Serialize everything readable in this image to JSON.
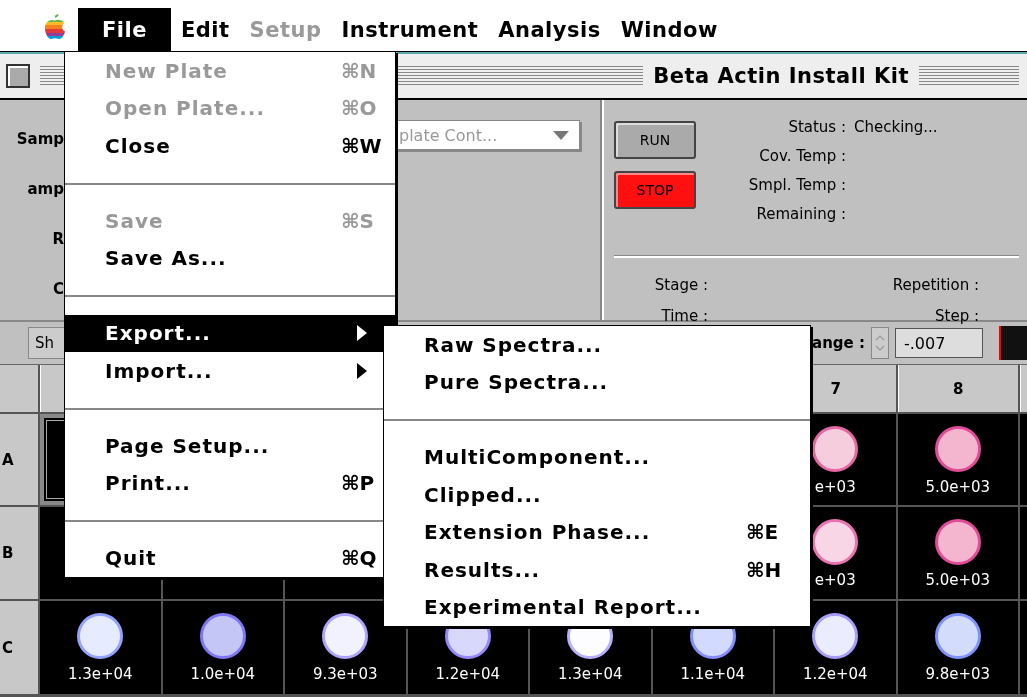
{
  "menu_bar": {
    "items": [
      {
        "label": "File",
        "selected": true,
        "disabled": false
      },
      {
        "label": "Edit",
        "selected": false,
        "disabled": false
      },
      {
        "label": "Setup",
        "selected": false,
        "disabled": true
      },
      {
        "label": "Instrument",
        "selected": false,
        "disabled": false
      },
      {
        "label": "Analysis",
        "selected": false,
        "disabled": false
      },
      {
        "label": "Window",
        "selected": false,
        "disabled": false
      }
    ]
  },
  "file_menu": {
    "items": [
      {
        "kind": "item",
        "label": "New Plate",
        "shortcut": "⌘N",
        "disabled": true,
        "selected": false,
        "submenu": false
      },
      {
        "kind": "item",
        "label": "Open Plate...",
        "shortcut": "⌘O",
        "disabled": true,
        "selected": false,
        "submenu": false
      },
      {
        "kind": "item",
        "label": "Close",
        "shortcut": "⌘W",
        "disabled": false,
        "selected": false,
        "submenu": false
      },
      {
        "kind": "separator"
      },
      {
        "kind": "item",
        "label": "Save",
        "shortcut": "⌘S",
        "disabled": true,
        "selected": false,
        "submenu": false
      },
      {
        "kind": "item",
        "label": "Save As...",
        "disabled": false,
        "selected": false,
        "submenu": false
      },
      {
        "kind": "separator"
      },
      {
        "kind": "item",
        "label": "Export...",
        "disabled": false,
        "selected": true,
        "submenu": true
      },
      {
        "kind": "item",
        "label": "Import...",
        "disabled": false,
        "selected": false,
        "submenu": true
      },
      {
        "kind": "separator"
      },
      {
        "kind": "item",
        "label": "Page Setup...",
        "disabled": false,
        "selected": false,
        "submenu": false
      },
      {
        "kind": "item",
        "label": "Print...",
        "shortcut": "⌘P",
        "disabled": false,
        "selected": false,
        "submenu": false
      },
      {
        "kind": "separator"
      },
      {
        "kind": "item",
        "label": "Quit",
        "shortcut": "⌘Q",
        "disabled": false,
        "selected": false,
        "submenu": false
      }
    ]
  },
  "export_submenu": {
    "items": [
      {
        "kind": "item",
        "label": "Raw Spectra...",
        "selected": false
      },
      {
        "kind": "item",
        "label": "Pure Spectra...",
        "selected": false
      },
      {
        "kind": "separator"
      },
      {
        "kind": "item",
        "label": "MultiComponent...",
        "selected": false
      },
      {
        "kind": "item",
        "label": "Clipped...",
        "selected": false
      },
      {
        "kind": "item",
        "label": "Extension Phase...",
        "shortcut": "⌘E",
        "selected": false
      },
      {
        "kind": "item",
        "label": "Results...",
        "shortcut": "⌘H",
        "selected": false
      },
      {
        "kind": "item",
        "label": "Experimental Report...",
        "selected": false
      }
    ]
  },
  "window": {
    "title": "Beta Actin Install Kit"
  },
  "setup_panel": {
    "labels": [
      "Samp",
      "amp",
      "R",
      "C"
    ],
    "template_dropdown": {
      "value": "plate Cont...",
      "disabled": true
    }
  },
  "run_panel": {
    "buttons": [
      {
        "label": "RUN",
        "kind": "run"
      },
      {
        "label": "STOP",
        "kind": "stop"
      }
    ],
    "status_fields": [
      {
        "label": "Status :",
        "value": "Checking..."
      },
      {
        "label": "Cov. Temp :"
      },
      {
        "label": "Smpl. Temp :"
      },
      {
        "label": "Remaining :"
      }
    ],
    "stage_fields": [
      {
        "label": "Stage :"
      },
      {
        "label": "Time :"
      }
    ],
    "repetition_fields": [
      {
        "label": "Repetition :"
      },
      {
        "label": "Step :"
      }
    ]
  },
  "toolbar": {
    "button": "Sh",
    "range_label": "ange :",
    "range_value": "-.007"
  },
  "plate": {
    "column_headers": [
      {
        "label": "7"
      },
      {
        "label": "8"
      }
    ],
    "rows": [
      {
        "label": "A",
        "cells": [
          {
            "selected": true
          },
          {},
          {},
          {},
          {},
          {},
          {
            "selected": false,
            "color": "#f6cddd",
            "value": "e+03"
          },
          {
            "selected": false,
            "color": "#f4b6cf",
            "value": "5.0e+03"
          },
          {
            "selected": false
          }
        ]
      },
      {
        "label": "B",
        "cells": [
          {
            "selected": false
          },
          {},
          {},
          {},
          {},
          {},
          {
            "selected": false,
            "color": "#f9d6e5",
            "value": "e+03"
          },
          {
            "selected": false,
            "color": "#f4b6cf",
            "value": "5.0e+03"
          },
          {
            "selected": false
          }
        ]
      },
      {
        "label": "C",
        "cells": [
          {
            "selected": false,
            "color": "#e6ebff",
            "value": "1.3e+04"
          },
          {
            "selected": false,
            "color": "#c4c6f6",
            "value": "1.0e+04"
          },
          {
            "selected": false,
            "color": "#f2f2ff",
            "value": "9.3e+03"
          },
          {
            "selected": false,
            "color": "#d8d8fb",
            "value": "1.2e+04"
          },
          {
            "selected": false,
            "color": "#fdfdff",
            "value": "1.3e+04"
          },
          {
            "selected": false,
            "color": "#d3daff",
            "value": "1.1e+04"
          },
          {
            "selected": false,
            "color": "#ececff",
            "value": "1.2e+04"
          },
          {
            "selected": false,
            "color": "#d3dcfb",
            "value": "9.8e+03"
          },
          {
            "selected": false
          }
        ]
      }
    ]
  }
}
